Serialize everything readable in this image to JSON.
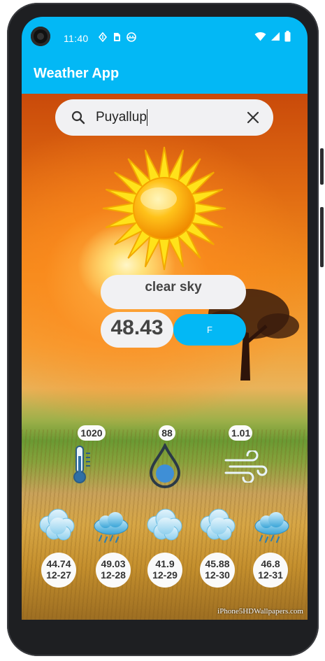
{
  "status_bar": {
    "time": "11:40",
    "icons": [
      "nav-arrow-icon",
      "sim-card-icon",
      "android-icon",
      "wifi-icon",
      "signal-icon",
      "battery-icon"
    ]
  },
  "app_bar": {
    "title": "Weather App"
  },
  "search": {
    "value": "Puyallup",
    "icon": "search-icon",
    "clear_icon": "close-icon"
  },
  "current": {
    "icon": "sun-icon",
    "description": "clear sky",
    "temperature": "48.43",
    "unit_button": "F"
  },
  "stats": [
    {
      "value": "1020",
      "icon": "thermometer-icon"
    },
    {
      "value": "88",
      "icon": "humidity-drop-icon"
    },
    {
      "value": "1.01",
      "icon": "wind-icon"
    }
  ],
  "forecast": [
    {
      "temp": "44.74",
      "date": "12-27",
      "icon": "cloudy-icon"
    },
    {
      "temp": "49.03",
      "date": "12-28",
      "icon": "rain-cloud-icon"
    },
    {
      "temp": "41.9",
      "date": "12-29",
      "icon": "cloudy-icon"
    },
    {
      "temp": "45.88",
      "date": "12-30",
      "icon": "cloudy-icon"
    },
    {
      "temp": "46.8",
      "date": "12-31",
      "icon": "rain-cloud-icon"
    }
  ],
  "watermark": "iPhone5HDWallpapers.com",
  "colors": {
    "accent": "#03b8f5",
    "pill": "#f1f1f3"
  }
}
